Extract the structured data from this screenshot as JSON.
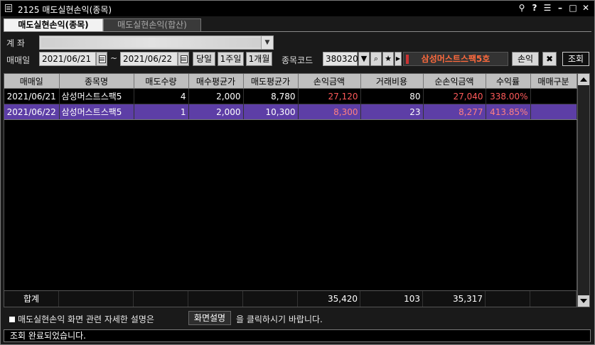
{
  "window": {
    "title": "2125 매도실현손익(종목)"
  },
  "tabs": [
    {
      "label": "매도실현손익(종목)"
    },
    {
      "label": "매도실현손익(합산)"
    }
  ],
  "form": {
    "account_label": "계 좌",
    "date_label": "매매일",
    "date_from": "2021/06/21",
    "tilde": "~",
    "date_to": "2021/06/22",
    "btn_today": "당일",
    "btn_week": "1주일",
    "btn_month": "1개월",
    "code_label": "종목코드",
    "code_value": "380320",
    "stock_name": "삼성머스트스팩5호",
    "pl_button": "손익",
    "query_button": "조회"
  },
  "table": {
    "headers": [
      "매매일",
      "종목명",
      "매도수량",
      "매수평균가",
      "매도평균가",
      "손익금액",
      "거래비용",
      "순손익금액",
      "수익률",
      "매매구분"
    ],
    "rows": [
      [
        "2021/06/21",
        "삼성머스트스팩5",
        "4",
        "2,000",
        "8,780",
        "27,120",
        "80",
        "27,040",
        "338.00%",
        ""
      ],
      [
        "2021/06/22",
        "삼성머스트스팩5",
        "1",
        "2,000",
        "10,300",
        "8,300",
        "23",
        "8,277",
        "413.85%",
        ""
      ]
    ],
    "summary": {
      "label": "합계",
      "pl": "35,420",
      "cost": "103",
      "net": "35,317"
    }
  },
  "help": {
    "prefix": "매도실현손익 화면 관련 자세한 설명은",
    "button": "화면설명",
    "suffix": "을 클릭하시기 바랍니다."
  },
  "status": "조회 완료되었습니다.",
  "colors": {
    "selected_row": "#5d3ea6",
    "profit": "#ff5a5a",
    "stock_name": "#ff6a3d"
  }
}
